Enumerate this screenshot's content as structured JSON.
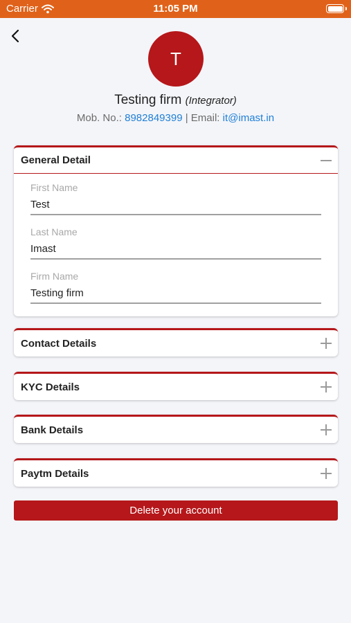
{
  "status_bar": {
    "carrier": "Carrier",
    "time": "11:05 PM"
  },
  "profile": {
    "avatar_initial": "T",
    "name": "Testing firm",
    "role": "(Integrator)",
    "mobile_label": "Mob. No.:",
    "mobile": "8982849399",
    "separator": "|",
    "email_label": "Email:",
    "email": "it@imast.in"
  },
  "sections": {
    "general": {
      "title": "General Detail",
      "fields": [
        {
          "label": "First Name",
          "value": "Test"
        },
        {
          "label": "Last Name",
          "value": "Imast"
        },
        {
          "label": "Firm Name",
          "value": "Testing firm"
        }
      ]
    },
    "contact": {
      "title": "Contact Details"
    },
    "kyc": {
      "title": "KYC Details"
    },
    "bank": {
      "title": "Bank Details"
    },
    "paytm": {
      "title": "Paytm Details"
    }
  },
  "actions": {
    "delete_label": "Delete your account"
  },
  "colors": {
    "status_bar": "#e0621a",
    "brand_red": "#b5171a",
    "link_blue": "#1f7fd6",
    "background": "#f4f5f9"
  },
  "icons": {
    "back": "chevron-left-icon",
    "collapse": "minus-icon",
    "expand": "plus-icon",
    "wifi": "wifi-icon",
    "battery": "battery-icon"
  }
}
